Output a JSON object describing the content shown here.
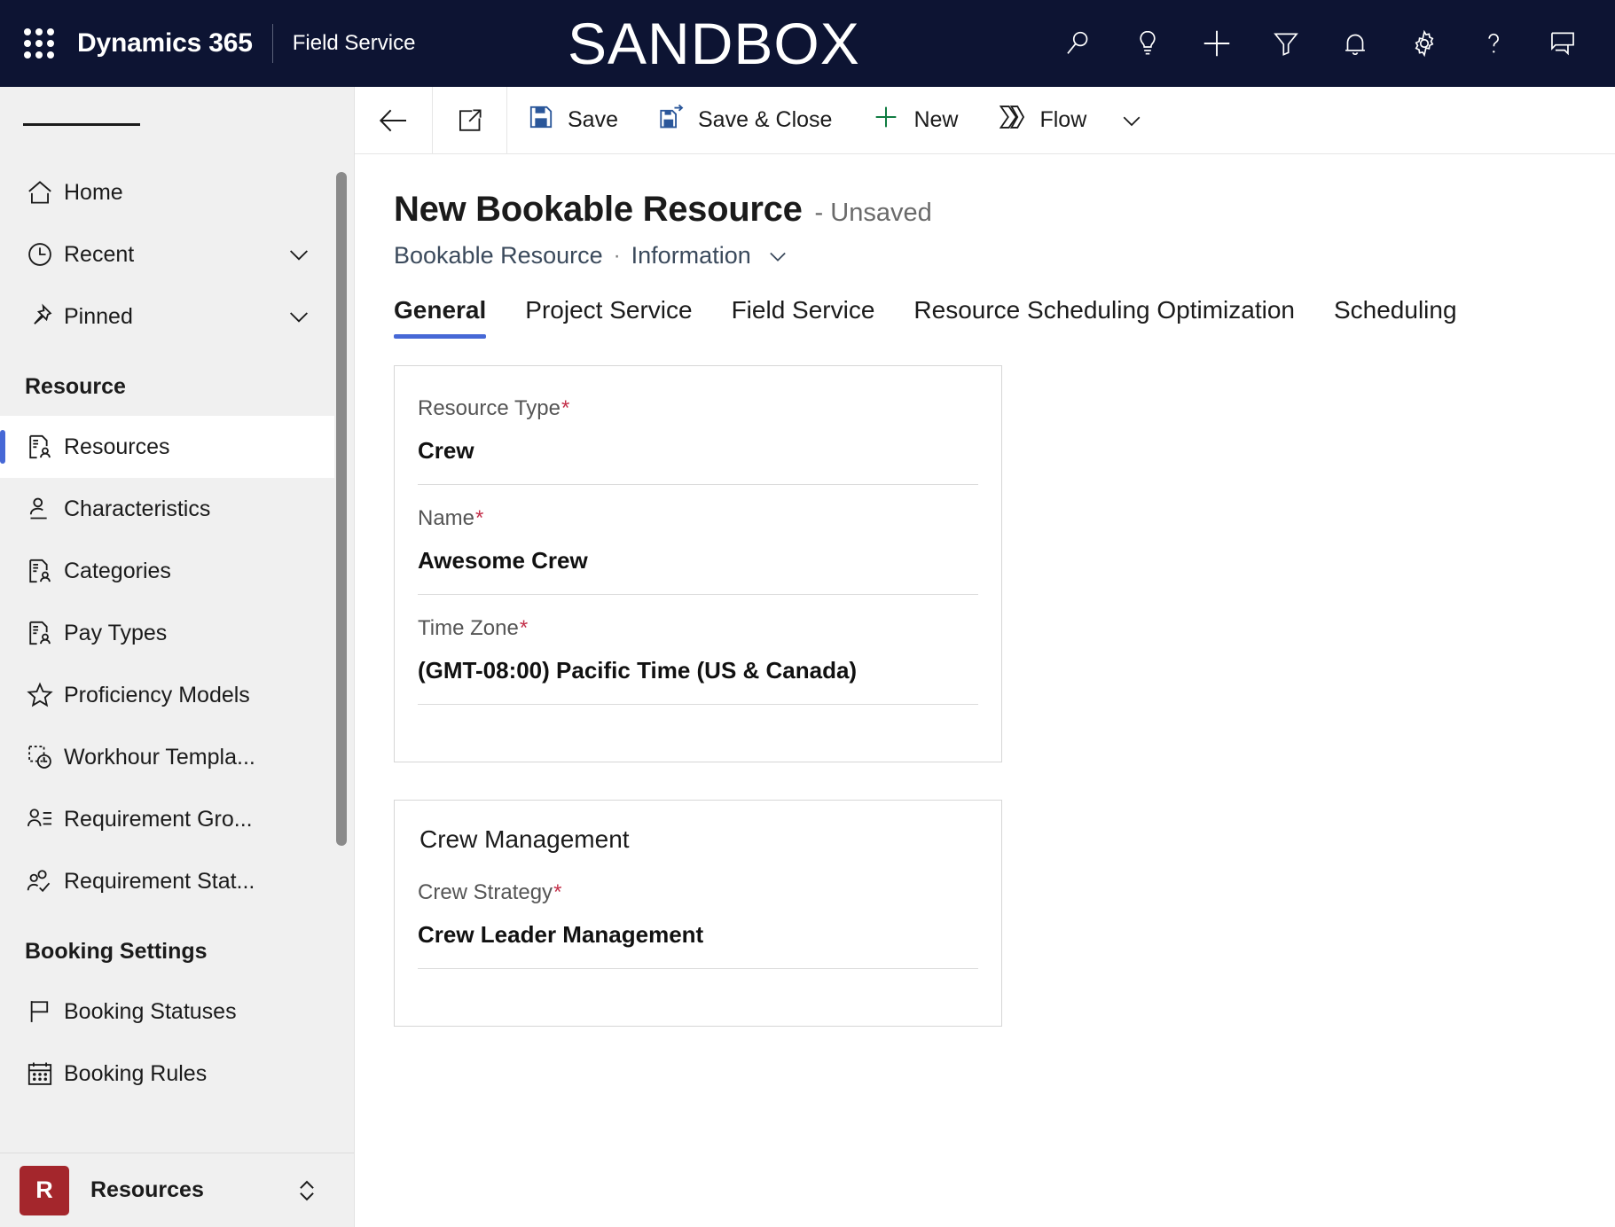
{
  "topnav": {
    "waffle_label": "app-launcher",
    "brand": "Dynamics 365",
    "app_name": "Field Service",
    "environment_banner": "SANDBOX",
    "icons": [
      {
        "name": "search-icon",
        "label": "Search"
      },
      {
        "name": "lightbulb-icon",
        "label": "Insights"
      },
      {
        "name": "plus-icon",
        "label": "Quick create"
      },
      {
        "name": "filter-icon",
        "label": "Filter"
      },
      {
        "name": "bell-icon",
        "label": "Notifications"
      },
      {
        "name": "gear-icon",
        "label": "Settings"
      },
      {
        "name": "question-icon",
        "label": "Help"
      },
      {
        "name": "chat-icon",
        "label": "Feedback"
      }
    ]
  },
  "sidebar": {
    "hamburger_label": "Expand / collapse navigation",
    "top_items": [
      {
        "label": "Home",
        "icon": "home-icon",
        "expandable": false
      },
      {
        "label": "Recent",
        "icon": "clock-icon",
        "expandable": true
      },
      {
        "label": "Pinned",
        "icon": "pin-icon",
        "expandable": true
      }
    ],
    "groups": [
      {
        "title": "Resource",
        "items": [
          {
            "label": "Resources",
            "icon": "resource-card-icon",
            "active": true
          },
          {
            "label": "Characteristics",
            "icon": "person-line-icon",
            "active": false
          },
          {
            "label": "Categories",
            "icon": "resource-card-icon",
            "active": false
          },
          {
            "label": "Pay Types",
            "icon": "resource-card-icon",
            "active": false
          },
          {
            "label": "Proficiency Models",
            "icon": "star-icon",
            "active": false
          },
          {
            "label": "Workhour Templa...",
            "icon": "clock-dashed-icon",
            "active": false
          },
          {
            "label": "Requirement Gro...",
            "icon": "person-list-icon",
            "active": false
          },
          {
            "label": "Requirement Stat...",
            "icon": "people-check-icon",
            "active": false
          }
        ]
      },
      {
        "title": "Booking Settings",
        "items": [
          {
            "label": "Booking Statuses",
            "icon": "flag-icon",
            "active": false
          },
          {
            "label": "Booking Rules",
            "icon": "calendar-icon",
            "active": false
          }
        ]
      }
    ],
    "footer": {
      "badge_letter": "R",
      "badge_color": "#a4262c",
      "label": "Resources",
      "switcher_icon": "chevron-up-down-icon"
    }
  },
  "commandbar": {
    "back_icon": "back-arrow-icon",
    "popout_icon": "open-in-new-window-icon",
    "buttons": [
      {
        "label": "Save",
        "icon": "save-icon"
      },
      {
        "label": "Save & Close",
        "icon": "save-and-close-icon"
      },
      {
        "label": "New",
        "icon": "plus-icon"
      },
      {
        "label": "Flow",
        "icon": "flow-icon"
      }
    ],
    "overflow_icon": "chevron-down-icon"
  },
  "record": {
    "title": "New Bookable Resource",
    "state": "- Unsaved",
    "breadcrumb_entity": "Bookable Resource",
    "breadcrumb_separator": "·",
    "breadcrumb_form": "Information",
    "form_chevron_icon": "chevron-down-icon"
  },
  "tabs": [
    {
      "label": "General",
      "active": true
    },
    {
      "label": "Project Service",
      "active": false
    },
    {
      "label": "Field Service",
      "active": false
    },
    {
      "label": "Resource Scheduling Optimization",
      "active": false
    },
    {
      "label": "Scheduling",
      "active": false
    }
  ],
  "form": {
    "sections": [
      {
        "title": "",
        "fields": [
          {
            "label": "Resource Type",
            "required": true,
            "value": "Crew"
          },
          {
            "label": "Name",
            "required": true,
            "value": "Awesome Crew"
          },
          {
            "label": "Time Zone",
            "required": true,
            "value": "(GMT-08:00) Pacific Time (US & Canada)"
          }
        ]
      },
      {
        "title": "Crew Management",
        "fields": [
          {
            "label": "Crew Strategy",
            "required": true,
            "value": "Crew Leader Management"
          }
        ]
      }
    ]
  },
  "colors": {
    "header_bg": "#0d1433",
    "accent_blue": "#4668d6",
    "required_red": "#c4314b",
    "sidebar_bg": "#f0f0f0",
    "save_icon_blue": "#2b579a",
    "new_icon_green": "#107c41"
  }
}
